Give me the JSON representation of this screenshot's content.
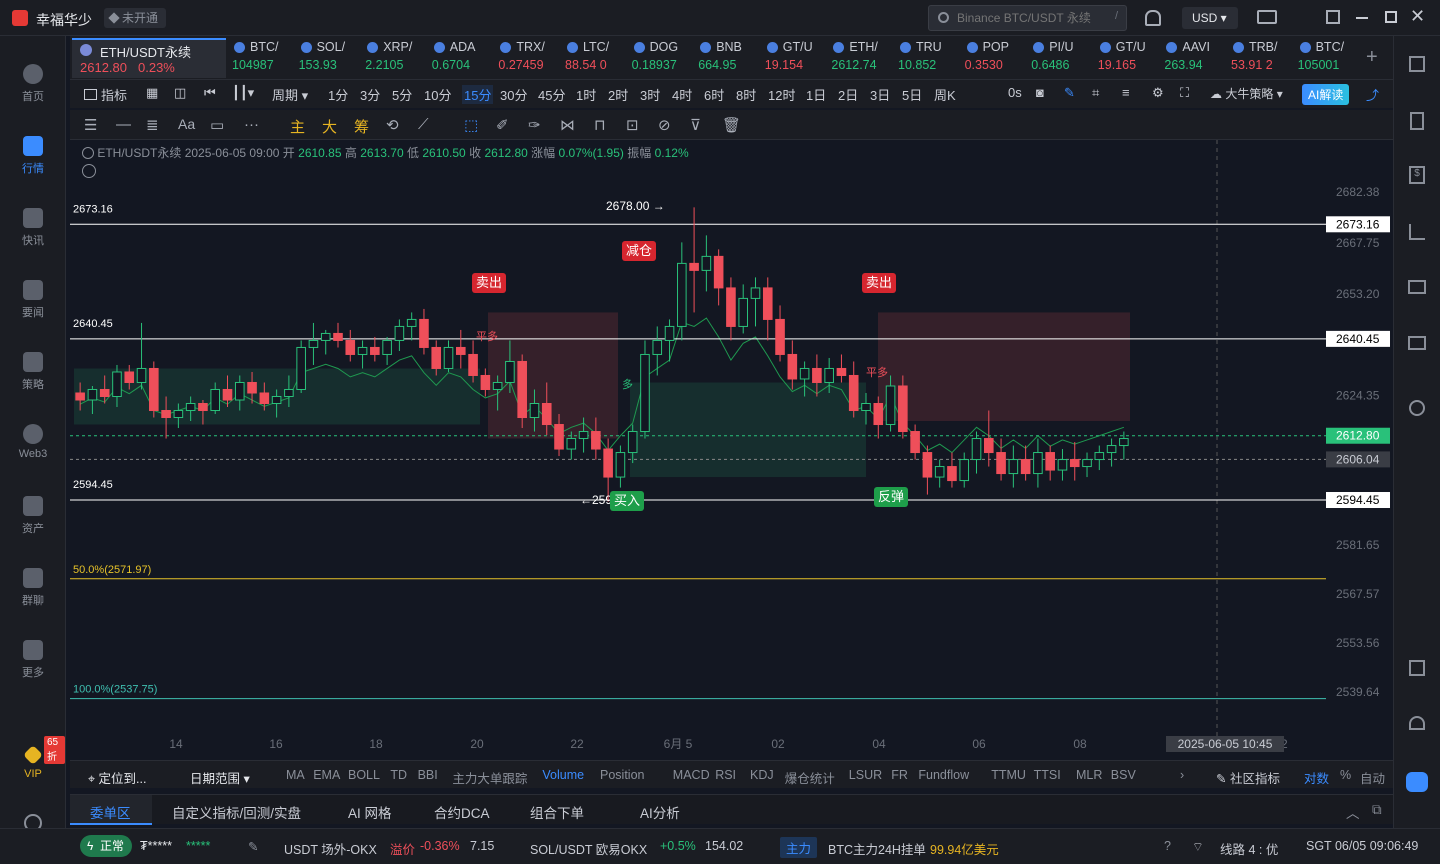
{
  "app": {
    "name": "幸福华少",
    "status_badge": "未开通"
  },
  "search": {
    "placeholder": "Binance BTC/USDT 永续",
    "shortcut": "/"
  },
  "currency": {
    "selected": "USD"
  },
  "sidebar": {
    "items": [
      {
        "label": "首页",
        "icon": "home-icon"
      },
      {
        "label": "行情",
        "icon": "chart-bars-icon",
        "active": true
      },
      {
        "label": "快讯",
        "icon": "news-icon"
      },
      {
        "label": "要闻",
        "icon": "article-icon"
      },
      {
        "label": "策略",
        "icon": "strategy-icon"
      },
      {
        "label": "Web3",
        "icon": "web3-icon"
      },
      {
        "label": "资产",
        "icon": "wallet-icon"
      },
      {
        "label": "群聊",
        "icon": "chat-icon"
      },
      {
        "label": "更多",
        "icon": "more-grid-icon"
      }
    ],
    "vip_badge": "65折",
    "vip_label": "VIP"
  },
  "active_ticker": {
    "name": "ETH/USDT永续",
    "price": "2612.80",
    "change": "0.23%"
  },
  "tickers": [
    {
      "name": "BTC/",
      "price": "104987",
      "dir": "up"
    },
    {
      "name": "SOL/",
      "price": "153.93",
      "dir": "up"
    },
    {
      "name": "XRP/",
      "price": "2.2105",
      "dir": "up"
    },
    {
      "name": "ADA",
      "price": "0.6704",
      "dir": "up"
    },
    {
      "name": "TRX/",
      "price": "0.27459",
      "dir": "dn"
    },
    {
      "name": "LTC/",
      "price": "88.54 0",
      "dir": "dn"
    },
    {
      "name": "DOG",
      "price": "0.18937",
      "dir": "up"
    },
    {
      "name": "BNB",
      "price": "664.95",
      "dir": "up"
    },
    {
      "name": "GT/U",
      "price": "19.154",
      "dir": "dn"
    },
    {
      "name": "ETH/",
      "price": "2612.74",
      "dir": "up"
    },
    {
      "name": "TRU",
      "price": "10.852",
      "dir": "up"
    },
    {
      "name": "POP",
      "price": "0.3530",
      "dir": "dn"
    },
    {
      "name": "PI/U",
      "price": "0.6486",
      "dir": "up"
    },
    {
      "name": "GT/U",
      "price": "19.165",
      "dir": "dn"
    },
    {
      "name": "AAVI",
      "price": "263.94",
      "dir": "up"
    },
    {
      "name": "TRB/",
      "price": "53.91 2",
      "dir": "dn"
    },
    {
      "name": "BTC/",
      "price": "105001",
      "dir": "up"
    }
  ],
  "toolbar": {
    "indicator_label": "指标",
    "period_label": "周期",
    "timeframes": [
      "1分",
      "3分",
      "5分",
      "10分",
      "15分",
      "30分",
      "45分",
      "1时",
      "2时",
      "3时",
      "4时",
      "6时",
      "8时",
      "12时",
      "1日",
      "2日",
      "3日",
      "5日",
      "周K"
    ],
    "active_timeframe": "15分",
    "countdown": "0s",
    "strategy_label": "大牛策略",
    "ai_button": "AI解读"
  },
  "drawtools": [
    "主",
    "大",
    "筹"
  ],
  "ohlc": {
    "symbol": "ETH/USDT永续",
    "time": "2025-06-05 09:00",
    "open_label": "开",
    "open": "2610.85",
    "high_label": "高",
    "high": "2613.70",
    "low_label": "低",
    "low": "2610.50",
    "close_label": "收",
    "close": "2612.80",
    "change_label": "涨幅",
    "change": "0.07%(1.95)",
    "amp_label": "振幅",
    "amp": "0.12%"
  },
  "chart_data": {
    "type": "candlestick",
    "y_ticks": [
      2682.38,
      2667.75,
      2653.2,
      2624.35,
      2581.65,
      2567.57,
      2553.56,
      2539.64
    ],
    "ylim": [
      2530,
      2690
    ],
    "x_ticks": [
      "14",
      "16",
      "18",
      "20",
      "22",
      "6月 5",
      "02",
      "04",
      "06",
      "08",
      "12"
    ],
    "current_price": "2612.80",
    "crosshair_price": "2606.04",
    "crosshair_time": "2025-06-05 10:45",
    "hlines": [
      {
        "value": 2673.16,
        "label": "2673.16",
        "color": "#ffffff"
      },
      {
        "value": 2640.45,
        "label": "2640.45",
        "color": "#ffffff"
      },
      {
        "value": 2594.45,
        "label": "2594.45",
        "color": "#ffffff"
      }
    ],
    "fib": [
      {
        "label": "50.0%(2571.97)",
        "value": 2571.97,
        "color": "#e6c229"
      },
      {
        "label": "100.0%(2537.75)",
        "value": 2537.75,
        "color": "#3fbfb0"
      }
    ],
    "annotations": {
      "high_mark": "2678.00",
      "low_mark": "259",
      "signals": [
        {
          "text": "卖出",
          "kind": "sell"
        },
        {
          "text": "减仓",
          "kind": "sell"
        },
        {
          "text": "卖出",
          "kind": "sell"
        },
        {
          "text": "买入",
          "kind": "buy"
        },
        {
          "text": "反弹",
          "kind": "buy"
        }
      ],
      "tags": [
        "平多",
        "多",
        "平多"
      ]
    },
    "candles": [
      [
        2625,
        2628,
        2620,
        2623
      ],
      [
        2623,
        2627,
        2619,
        2626
      ],
      [
        2626,
        2630,
        2622,
        2624
      ],
      [
        2624,
        2633,
        2621,
        2631
      ],
      [
        2631,
        2633,
        2626,
        2628
      ],
      [
        2628,
        2645,
        2626,
        2632
      ],
      [
        2632,
        2634,
        2618,
        2620
      ],
      [
        2620,
        2624,
        2612,
        2618
      ],
      [
        2618,
        2622,
        2615,
        2620
      ],
      [
        2620,
        2624,
        2617,
        2622
      ],
      [
        2622,
        2623,
        2616,
        2620
      ],
      [
        2620,
        2628,
        2619,
        2626
      ],
      [
        2626,
        2630,
        2621,
        2623
      ],
      [
        2623,
        2630,
        2620,
        2628
      ],
      [
        2628,
        2631,
        2622,
        2625
      ],
      [
        2625,
        2628,
        2620,
        2622
      ],
      [
        2622,
        2626,
        2618,
        2624
      ],
      [
        2624,
        2630,
        2621,
        2626
      ],
      [
        2626,
        2640,
        2625,
        2638
      ],
      [
        2638,
        2645,
        2633,
        2640
      ],
      [
        2640,
        2643,
        2636,
        2642
      ],
      [
        2642,
        2645,
        2638,
        2640
      ],
      [
        2640,
        2643,
        2634,
        2636
      ],
      [
        2636,
        2640,
        2632,
        2638
      ],
      [
        2638,
        2641,
        2634,
        2636
      ],
      [
        2636,
        2641,
        2633,
        2640
      ],
      [
        2640,
        2646,
        2637,
        2644
      ],
      [
        2644,
        2648,
        2640,
        2646
      ],
      [
        2646,
        2649,
        2636,
        2638
      ],
      [
        2638,
        2640,
        2630,
        2632
      ],
      [
        2632,
        2640,
        2631,
        2638
      ],
      [
        2638,
        2643,
        2632,
        2636
      ],
      [
        2636,
        2640,
        2628,
        2630
      ],
      [
        2630,
        2632,
        2624,
        2626
      ],
      [
        2626,
        2630,
        2620,
        2628
      ],
      [
        2628,
        2640,
        2625,
        2634
      ],
      [
        2634,
        2636,
        2615,
        2618
      ],
      [
        2618,
        2626,
        2614,
        2622
      ],
      [
        2622,
        2628,
        2613,
        2616
      ],
      [
        2616,
        2619,
        2607,
        2609
      ],
      [
        2609,
        2614,
        2606,
        2612
      ],
      [
        2612,
        2618,
        2608,
        2614
      ],
      [
        2614,
        2618,
        2606,
        2609
      ],
      [
        2609,
        2612,
        2594,
        2601
      ],
      [
        2601,
        2610,
        2598,
        2608
      ],
      [
        2608,
        2616,
        2605,
        2614
      ],
      [
        2614,
        2640,
        2612,
        2636
      ],
      [
        2636,
        2644,
        2630,
        2640
      ],
      [
        2640,
        2646,
        2634,
        2644
      ],
      [
        2644,
        2668,
        2640,
        2662
      ],
      [
        2662,
        2678,
        2648,
        2660
      ],
      [
        2660,
        2670,
        2654,
        2664
      ],
      [
        2664,
        2666,
        2650,
        2655
      ],
      [
        2655,
        2658,
        2640,
        2644
      ],
      [
        2644,
        2656,
        2642,
        2652
      ],
      [
        2652,
        2658,
        2644,
        2655
      ],
      [
        2655,
        2658,
        2640,
        2646
      ],
      [
        2646,
        2650,
        2634,
        2636
      ],
      [
        2636,
        2640,
        2626,
        2629
      ],
      [
        2629,
        2634,
        2624,
        2632
      ],
      [
        2632,
        2636,
        2624,
        2628
      ],
      [
        2628,
        2635,
        2625,
        2632
      ],
      [
        2632,
        2636,
        2628,
        2630
      ],
      [
        2630,
        2634,
        2618,
        2620
      ],
      [
        2620,
        2625,
        2616,
        2622
      ],
      [
        2622,
        2624,
        2612,
        2616
      ],
      [
        2616,
        2630,
        2614,
        2627
      ],
      [
        2627,
        2630,
        2612,
        2614
      ],
      [
        2614,
        2616,
        2606,
        2608
      ],
      [
        2608,
        2610,
        2596,
        2601
      ],
      [
        2601,
        2606,
        2598,
        2604
      ],
      [
        2604,
        2608,
        2598,
        2600
      ],
      [
        2600,
        2608,
        2598,
        2606
      ],
      [
        2606,
        2614,
        2602,
        2612
      ],
      [
        2612,
        2620,
        2604,
        2608
      ],
      [
        2608,
        2612,
        2600,
        2602
      ],
      [
        2602,
        2610,
        2598,
        2606
      ],
      [
        2606,
        2610,
        2600,
        2602
      ],
      [
        2602,
        2612,
        2598,
        2608
      ],
      [
        2608,
        2610,
        2600,
        2603
      ],
      [
        2603,
        2609,
        2600,
        2606
      ],
      [
        2606,
        2611,
        2600,
        2604
      ],
      [
        2604,
        2608,
        2601,
        2606
      ],
      [
        2606,
        2610,
        2603,
        2608
      ],
      [
        2608,
        2612,
        2604,
        2610
      ],
      [
        2610,
        2614,
        2606,
        2612
      ]
    ]
  },
  "indicator_tabs": {
    "locate": "定位到...",
    "date_range": "日期范围",
    "items": [
      "MA",
      "EMA",
      "BOLL",
      "TD",
      "BBI",
      "主力大单跟踪",
      "Volume",
      "Position",
      "MACD",
      "RSI",
      "KDJ",
      "爆仓统计",
      "LSUR",
      "FR",
      "Fundflow",
      "TTMU",
      "TTSI",
      "MLR",
      "BSV"
    ],
    "active": "Volume",
    "community": "社区指标",
    "log_label": "对数",
    "pct_label": "%",
    "auto_label": "自动"
  },
  "panel_tabs": [
    "委单区",
    "自定义指标/回测/实盘",
    "AI 网格",
    "合约DCA",
    "组合下单",
    "AI分析"
  ],
  "status": {
    "state": "正常",
    "masked_user": "₮*****",
    "stars": "*****",
    "items": [
      {
        "label": "USDT 场外-OKX",
        "tag": "溢价",
        "change": "-0.36%",
        "value": "7.15"
      },
      {
        "label": "SOL/USDT 欧易OKX",
        "change": "+0.5%",
        "value": "154.02"
      }
    ],
    "main_tag": "主力",
    "main_text": "BTC主力24H挂单",
    "main_value": "99.94亿美元",
    "route": "线路 4 : 优",
    "clock": "SGT 06/05 09:06:49"
  }
}
